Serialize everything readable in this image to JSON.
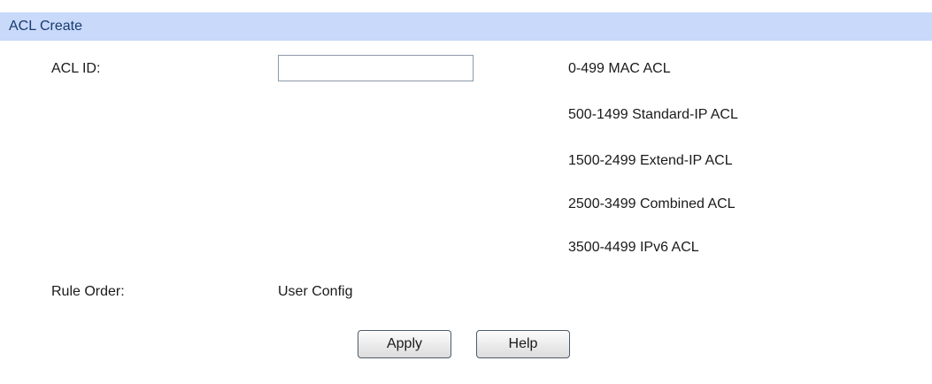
{
  "panel": {
    "title": "ACL Create"
  },
  "form": {
    "acl_id_label": "ACL ID:",
    "acl_id_value": "",
    "ranges": [
      "0-499 MAC ACL",
      "500-1499 Standard-IP ACL",
      "1500-2499 Extend-IP ACL",
      "2500-3499 Combined ACL",
      "3500-4499 IPv6 ACL"
    ],
    "rule_order_label": "Rule Order:",
    "rule_order_value": "User Config"
  },
  "actions": {
    "apply_label": "Apply",
    "help_label": "Help"
  },
  "colors": {
    "header_bg": "#c8d9fa",
    "header_text": "#1a3a6e"
  }
}
